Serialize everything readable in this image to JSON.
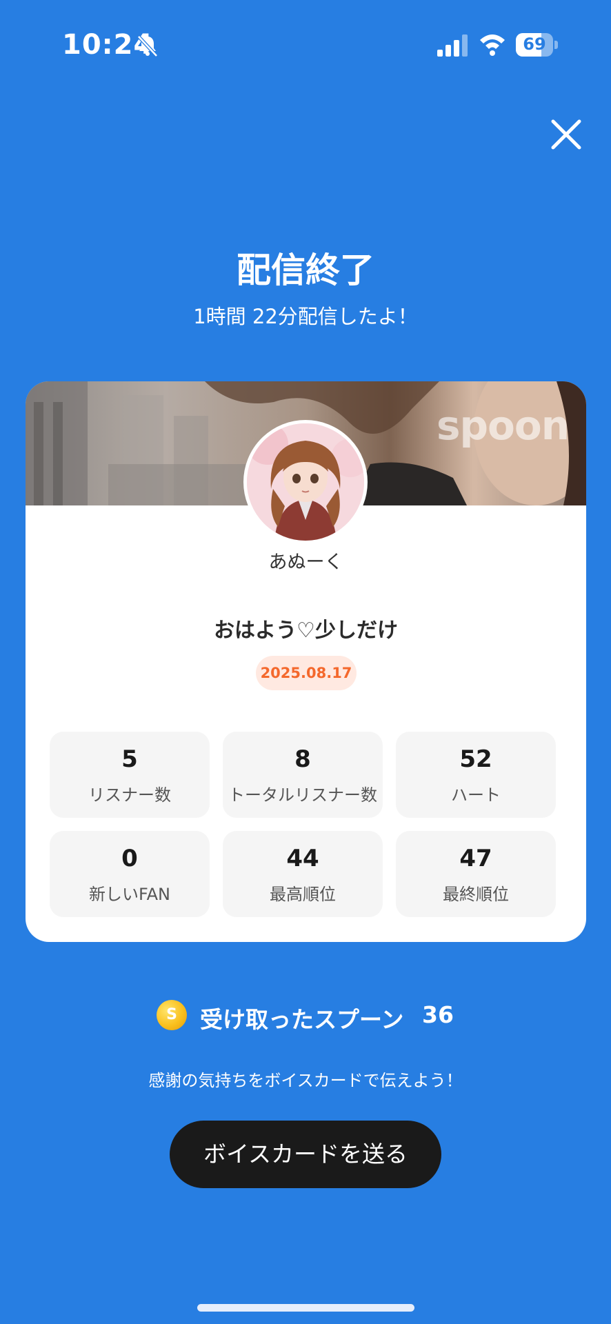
{
  "status_bar": {
    "time": "10:24",
    "battery": "69"
  },
  "header": {
    "title": "配信終了",
    "subtitle": "1時間 22分配信したよ！"
  },
  "card": {
    "watermark": "spoon",
    "username": "あぬーく",
    "live_title": "おはよう♡少しだけ",
    "date": "2025.08.17",
    "stats": [
      {
        "value": "5",
        "label": "リスナー数"
      },
      {
        "value": "8",
        "label": "トータルリスナー数"
      },
      {
        "value": "52",
        "label": "ハート"
      },
      {
        "value": "0",
        "label": "新しいFAN"
      },
      {
        "value": "44",
        "label": "最高順位"
      },
      {
        "value": "47",
        "label": "最終順位"
      }
    ]
  },
  "spoons": {
    "coin_symbol": "S",
    "label": "受け取ったスプーン",
    "count": "36"
  },
  "thanks_message": "感謝の気持ちをボイスカードで伝えよう！",
  "voice_card_button": "ボイスカードを送る",
  "colors": {
    "background": "#277ee2",
    "date_badge_text": "#f4682c",
    "date_badge_bg": "#ffe9e1",
    "button_bg": "#1a1a1a"
  }
}
